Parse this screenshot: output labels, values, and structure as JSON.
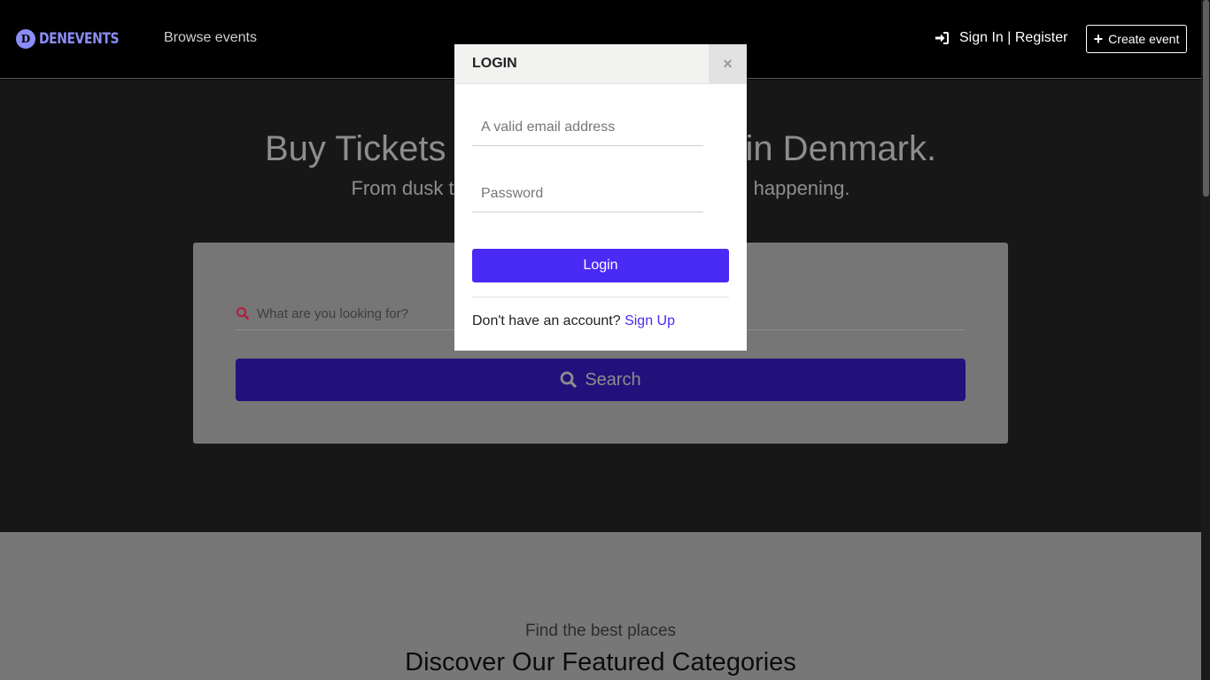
{
  "nav": {
    "logo_letter": "D",
    "logo_text": "DENEVENTS",
    "browse_label": "Browse events",
    "signin_label": "Sign In | Register",
    "create_label": "Create event"
  },
  "hero": {
    "title": "Buy Tickets to the best events in Denmark.",
    "subtitle": "From dusk till dawn, there's always something happening.",
    "search_placeholder": "What are you looking for?",
    "search_button": "Search"
  },
  "section": {
    "subtitle": "Find the best places",
    "title": "Discover Our Featured Categories"
  },
  "modal": {
    "title": "LOGIN",
    "close": "×",
    "email_placeholder": "A valid email address",
    "password_placeholder": "Password",
    "login_button": "Login",
    "footer_text": "Don't have an account? ",
    "signup_link": "Sign Up"
  },
  "colors": {
    "accent": "#4a2af5",
    "logo": "#8a8df5",
    "search_icon": "#b81a3b"
  }
}
